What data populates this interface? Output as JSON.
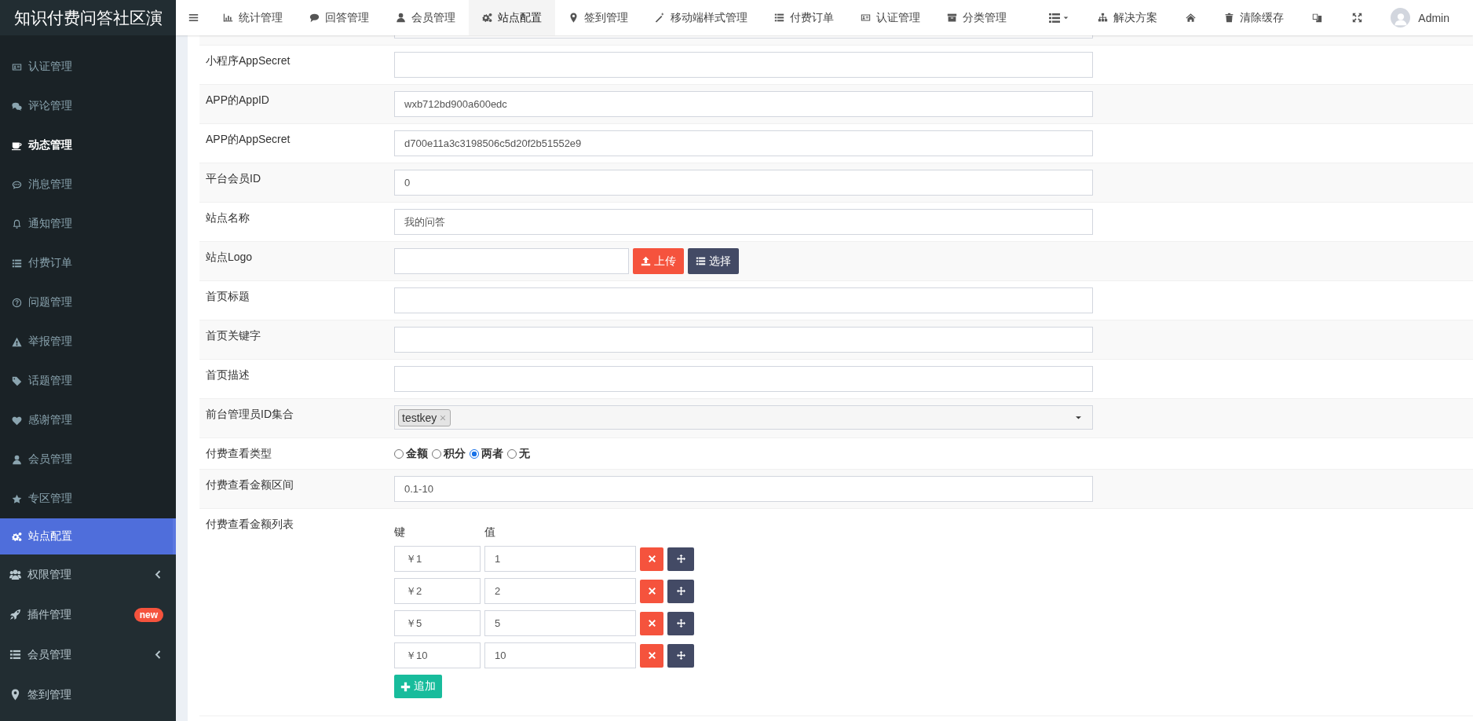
{
  "brand": "知识付费问答社区演",
  "topnav": {
    "items": [
      {
        "label": "统计管理",
        "selected": false
      },
      {
        "label": "回答管理",
        "selected": false
      },
      {
        "label": "会员管理",
        "selected": false
      },
      {
        "label": "站点配置",
        "selected": true
      },
      {
        "label": "签到管理",
        "selected": false
      },
      {
        "label": "移动端样式管理",
        "selected": false
      },
      {
        "label": "付费订单",
        "selected": false
      },
      {
        "label": "认证管理",
        "selected": false
      },
      {
        "label": "分类管理",
        "selected": false
      }
    ],
    "right": [
      {
        "kind": "dropdown"
      },
      {
        "kind": "link",
        "label": "解决方案"
      },
      {
        "kind": "icon"
      },
      {
        "kind": "link",
        "label": "清除缓存"
      },
      {
        "kind": "icon"
      },
      {
        "kind": "icon"
      },
      {
        "kind": "user",
        "label": "Admin"
      }
    ]
  },
  "sidebar": {
    "items": [
      {
        "kind": "link",
        "label": "认证管理",
        "selected": false,
        "hovered": false
      },
      {
        "kind": "link",
        "label": "评论管理",
        "selected": false,
        "hovered": false
      },
      {
        "kind": "link",
        "label": "动态管理",
        "selected": false,
        "hovered": true
      },
      {
        "kind": "link",
        "label": "消息管理",
        "selected": false,
        "hovered": false
      },
      {
        "kind": "link",
        "label": "通知管理",
        "selected": false,
        "hovered": false
      },
      {
        "kind": "link",
        "label": "付费订单",
        "selected": false,
        "hovered": false
      },
      {
        "kind": "link",
        "label": "问题管理",
        "selected": false,
        "hovered": false
      },
      {
        "kind": "link",
        "label": "举报管理",
        "selected": false,
        "hovered": false
      },
      {
        "kind": "link",
        "label": "话题管理",
        "selected": false,
        "hovered": false
      },
      {
        "kind": "link",
        "label": "感谢管理",
        "selected": false,
        "hovered": false
      },
      {
        "kind": "link",
        "label": "会员管理",
        "selected": false,
        "hovered": false
      },
      {
        "kind": "link",
        "label": "专区管理",
        "selected": false,
        "hovered": false
      },
      {
        "kind": "link",
        "label": "站点配置",
        "selected": true,
        "hovered": false
      },
      {
        "kind": "group",
        "label": "权限管理",
        "expanded": false
      },
      {
        "kind": "group",
        "label": "插件管理",
        "badge": "new"
      },
      {
        "kind": "group",
        "label": "会员管理",
        "expanded": false
      },
      {
        "kind": "group",
        "label": "签到管理"
      }
    ]
  },
  "form": {
    "rows": [
      {
        "kind": "text"
      },
      {
        "kind": "text",
        "label": "小程序AppSecret"
      },
      {
        "kind": "text",
        "label": "APP的AppID",
        "value": "wxb712bd900a600edc"
      },
      {
        "kind": "text",
        "label": "APP的AppSecret",
        "value": "d700e11a3c3198506c5d20f2b51552e9"
      },
      {
        "kind": "text",
        "label": "平台会员ID",
        "value": "0"
      },
      {
        "kind": "text",
        "label": "站点名称",
        "value": "我的问答"
      },
      {
        "kind": "upload",
        "label": "站点Logo",
        "buttons": [
          "上传",
          "选择"
        ]
      },
      {
        "kind": "text",
        "label": "首页标题"
      },
      {
        "kind": "text",
        "label": "首页关键字"
      },
      {
        "kind": "text",
        "label": "首页描述"
      },
      {
        "kind": "tags",
        "label": "前台管理员ID集合",
        "tags": [
          "testkey"
        ]
      },
      {
        "kind": "radios",
        "label": "付费查看类型",
        "options": [
          {
            "label": "金额",
            "selected": false
          },
          {
            "label": "积分",
            "selected": false
          },
          {
            "label": "两者",
            "selected": true
          },
          {
            "label": "无",
            "selected": false
          }
        ]
      },
      {
        "kind": "text",
        "label": "付费查看金额区间",
        "value": "0.1-10"
      },
      {
        "kind": "keyvalue",
        "label": "付费查看金额列表",
        "headers": [
          "键",
          "值"
        ],
        "rows": [
          {
            "key": "￥1",
            "value": "1"
          },
          {
            "key": "￥2",
            "value": "2"
          },
          {
            "key": "￥5",
            "value": "5"
          },
          {
            "key": "￥10",
            "value": "10"
          }
        ],
        "add_button": "追加"
      }
    ]
  }
}
